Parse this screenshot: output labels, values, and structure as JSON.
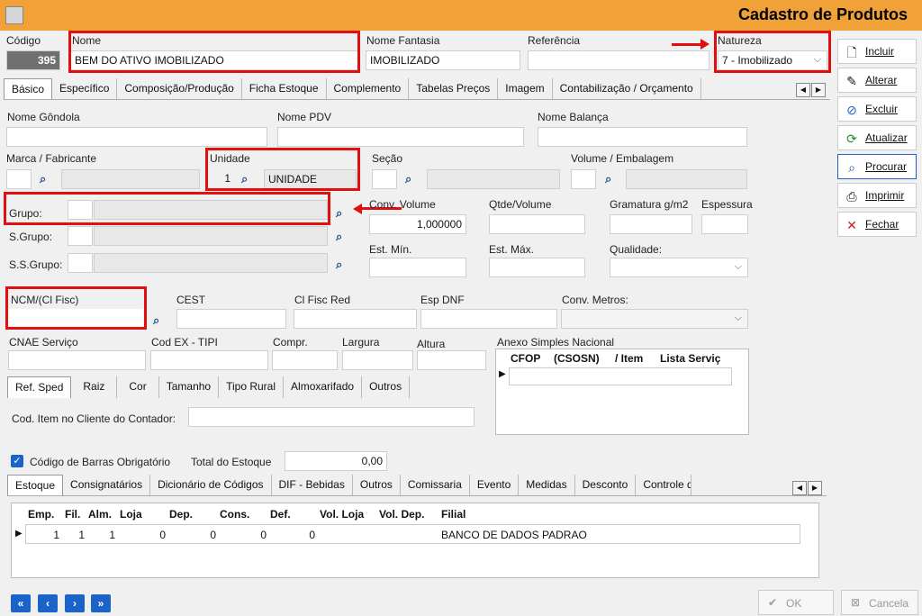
{
  "window": {
    "title": "Cadastro de Produtos"
  },
  "header": {
    "codigo_label": "Código",
    "codigo_value": "395",
    "nome_label": "Nome",
    "nome_value": "BEM DO ATIVO IMOBILIZADO",
    "fantasia_label": "Nome Fantasia",
    "fantasia_value": "IMOBILIZADO",
    "referencia_label": "Referência",
    "referencia_value": "",
    "natureza_label": "Natureza",
    "natureza_value": "7 - Imobilizado"
  },
  "main_tabs": [
    "Básico",
    "Específico",
    "Composição/Produção",
    "Ficha Estoque",
    "Complemento",
    "Tabelas Preços",
    "Imagem",
    "Contabilização / Orçamento"
  ],
  "sidebar": {
    "incluir": "Incluir",
    "alterar": "Alterar",
    "excluir": "Excluir",
    "atualizar": "Atualizar",
    "procurar": "Procurar",
    "imprimir": "Imprimir",
    "fechar": "Fechar"
  },
  "basico": {
    "nome_gondola": "Nome Gôndola",
    "nome_pdv": "Nome PDV",
    "nome_balanca": "Nome Balança",
    "marca": "Marca / Fabricante",
    "unidade": "Unidade",
    "unidade_code": "1",
    "unidade_desc": "UNIDADE",
    "secao": "Seção",
    "volume_emb": "Volume / Embalagem",
    "grupo": "Grupo:",
    "sgrupo": "S.Grupo:",
    "ssgrupo": "S.S.Grupo:",
    "conv_volume": "Conv. Volume",
    "conv_volume_value": "1,000000",
    "qtde_volume": "Qtde/Volume",
    "gramatura": "Gramatura g/m2",
    "espessura": "Espessura",
    "est_min": "Est. Mín.",
    "est_max": "Est. Máx.",
    "qualidade": "Qualidade:",
    "ncm": "NCM/(Cl Fisc)",
    "cest": "CEST",
    "cl_fisc_red": "Cl Fisc Red",
    "esp_dnf": "Esp DNF",
    "conv_metros": "Conv. Metros:",
    "cnae": "CNAE Serviço",
    "cod_ex": "Cod EX - TIPI",
    "compr": "Compr.",
    "largura": "Largura",
    "altura": "Altura",
    "anexo": "Anexo Simples Nacional",
    "anexo_cols": [
      "CFOP",
      "(CSOSN)",
      "/ Item",
      "Lista Serviç"
    ],
    "cod_item_contador": "Cod. Item no Cliente do Contador:"
  },
  "sub_tabs": [
    "Ref. Sped",
    "Raiz",
    "Cor",
    "Tamanho",
    "Tipo Rural",
    "Almoxarifado",
    "Outros"
  ],
  "bottom": {
    "cod_barras_obrig": "Código de Barras Obrigatório",
    "total_estoque_label": "Total do Estoque",
    "total_estoque_value": "0,00"
  },
  "bottom_tabs": [
    "Estoque",
    "Consignatários",
    "Dicionário de Códigos",
    "DIF - Bebidas",
    "Outros",
    "Comissaria",
    "Evento",
    "Medidas",
    "Desconto",
    "Controle d"
  ],
  "estoque_grid": {
    "columns": [
      "Emp.",
      "Fil.",
      "Alm.",
      "Loja",
      "Dep.",
      "Cons.",
      "Def.",
      "Vol. Loja",
      "Vol. Dep.",
      "Filial"
    ],
    "rows": [
      [
        "1",
        "1",
        "1",
        "0",
        "0",
        "0",
        "0",
        "",
        "",
        "BANCO DE DADOS PADRAO"
      ]
    ]
  },
  "footer": {
    "ok": "OK",
    "cancela": "Cancela"
  },
  "colors": {
    "titlebar": "#f0a238",
    "annotation": "#e01010",
    "nav": "#1b62c9"
  }
}
